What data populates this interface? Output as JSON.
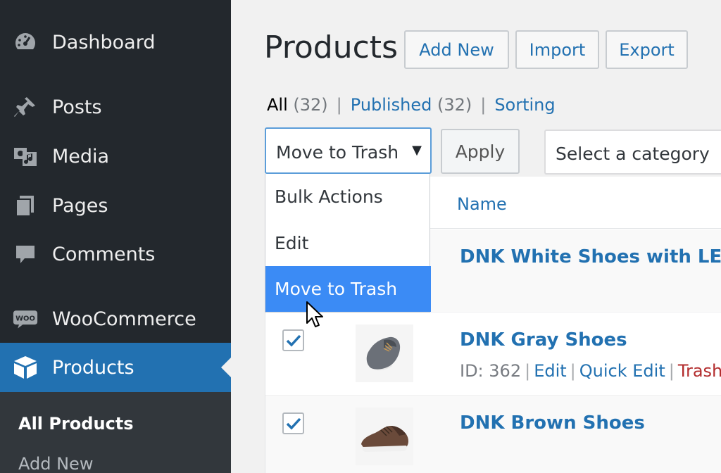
{
  "sidebar": {
    "items": [
      {
        "label": "Dashboard",
        "icon": "dashboard-icon"
      },
      {
        "label": "Posts",
        "icon": "pin-icon"
      },
      {
        "label": "Media",
        "icon": "media-icon"
      },
      {
        "label": "Pages",
        "icon": "pages-icon"
      },
      {
        "label": "Comments",
        "icon": "comment-icon"
      },
      {
        "label": "WooCommerce",
        "icon": "woocommerce-icon"
      },
      {
        "label": "Products",
        "icon": "box-icon"
      }
    ],
    "woo_badge": "WOO",
    "submenu": [
      "All Products",
      "Add New"
    ]
  },
  "header": {
    "title": "Products",
    "buttons": [
      "Add New",
      "Import",
      "Export"
    ]
  },
  "filters": {
    "all_label": "All",
    "all_count": "(32)",
    "published_label": "Published",
    "published_count": "(32)",
    "sorting_label": "Sorting",
    "sep": "|"
  },
  "bulk": {
    "selected": "Move to Trash",
    "arrow": "▼",
    "options": [
      "Bulk Actions",
      "Edit",
      "Move to Trash"
    ],
    "apply": "Apply",
    "category_placeholder": "Select a category"
  },
  "table": {
    "col_name": "Name",
    "rows": [
      {
        "name": "DNK White Shoes with LED"
      },
      {
        "name": "DNK Gray Shoes",
        "checked": true,
        "id_text": "ID: 362",
        "actions": [
          "Edit",
          "Quick Edit",
          "Trash"
        ]
      },
      {
        "name": "DNK Brown Shoes",
        "checked": true
      }
    ]
  },
  "colors": {
    "sidebar_bg": "#23282d",
    "active_bg": "#2271b1",
    "link": "#2271b1",
    "highlight": "#3b8bf5",
    "trash": "#b32d2e"
  }
}
